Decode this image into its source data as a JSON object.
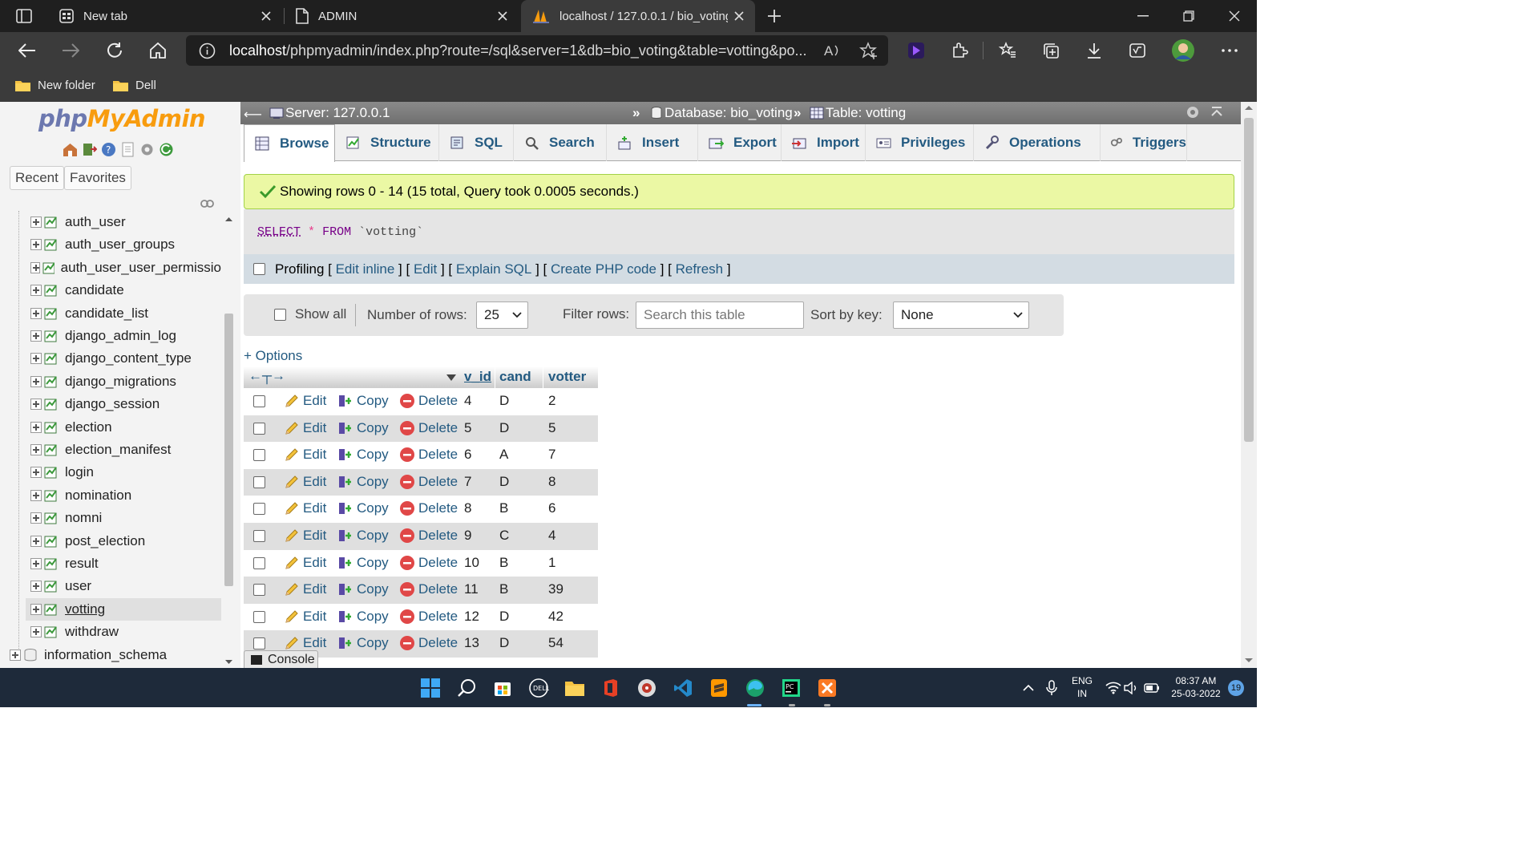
{
  "browser": {
    "tabs": [
      {
        "title": "New tab",
        "active": false
      },
      {
        "title": "ADMIN",
        "active": false
      },
      {
        "title": "localhost / 127.0.0.1 / bio_voting",
        "active": true
      }
    ],
    "address": {
      "host": "localhost",
      "path": "/phpmyadmin/index.php?route=/sql&server=1&db=bio_voting&table=votting&po..."
    },
    "bookmarks": [
      "New folder",
      "Dell"
    ]
  },
  "pma": {
    "logo_php": "php",
    "logo_myadmin": "MyAdmin",
    "nav_tabs": [
      "Recent",
      "Favorites"
    ],
    "tables": [
      "auth_user",
      "auth_user_groups",
      "auth_user_user_permissio",
      "candidate",
      "candidate_list",
      "django_admin_log",
      "django_content_type",
      "django_migrations",
      "django_session",
      "election",
      "election_manifest",
      "login",
      "nomination",
      "nomni",
      "post_election",
      "result",
      "user",
      "votting",
      "withdraw"
    ],
    "selected_table": "votting",
    "other_db": "information_schema",
    "breadcrumb": {
      "server": "Server: 127.0.0.1",
      "database": "Database: bio_voting",
      "table": "Table: votting",
      "sep": "»"
    },
    "menu": [
      "Browse",
      "Structure",
      "SQL",
      "Search",
      "Insert",
      "Export",
      "Import",
      "Privileges",
      "Operations",
      "Triggers"
    ],
    "active_menu": "Browse",
    "success_message": "Showing rows 0 - 14 (15 total, Query took 0.0005 seconds.)",
    "sql": {
      "select": "SELECT",
      "star": "*",
      "from": "FROM",
      "table": "`votting`"
    },
    "profiling": {
      "label": "Profiling",
      "links": [
        "Edit inline",
        "Edit",
        "Explain SQL",
        "Create PHP code",
        "Refresh"
      ]
    },
    "nav": {
      "show_all": "Show all",
      "rows_label": "Number of rows:",
      "rows_value": "25",
      "filter_label": "Filter rows:",
      "filter_placeholder": "Search this table",
      "sort_label": "Sort by key:",
      "sort_value": "None"
    },
    "options_link": "+ Options",
    "columns": [
      "v_id",
      "cand",
      "votter"
    ],
    "actions": {
      "edit": "Edit",
      "copy": "Copy",
      "delete": "Delete"
    },
    "rows": [
      {
        "v_id": "4",
        "cand": "D",
        "votter": "2"
      },
      {
        "v_id": "5",
        "cand": "D",
        "votter": "5"
      },
      {
        "v_id": "6",
        "cand": "A",
        "votter": "7"
      },
      {
        "v_id": "7",
        "cand": "D",
        "votter": "8"
      },
      {
        "v_id": "8",
        "cand": "B",
        "votter": "6"
      },
      {
        "v_id": "9",
        "cand": "C",
        "votter": "4"
      },
      {
        "v_id": "10",
        "cand": "B",
        "votter": "1"
      },
      {
        "v_id": "11",
        "cand": "B",
        "votter": "39"
      },
      {
        "v_id": "12",
        "cand": "D",
        "votter": "42"
      },
      {
        "v_id": "13",
        "cand": "D",
        "votter": "54"
      }
    ],
    "console_label": "Console"
  },
  "taskbar": {
    "lang": "ENG",
    "region": "IN",
    "time": "08:37 AM",
    "date": "25-03-2022",
    "badge": "19"
  }
}
